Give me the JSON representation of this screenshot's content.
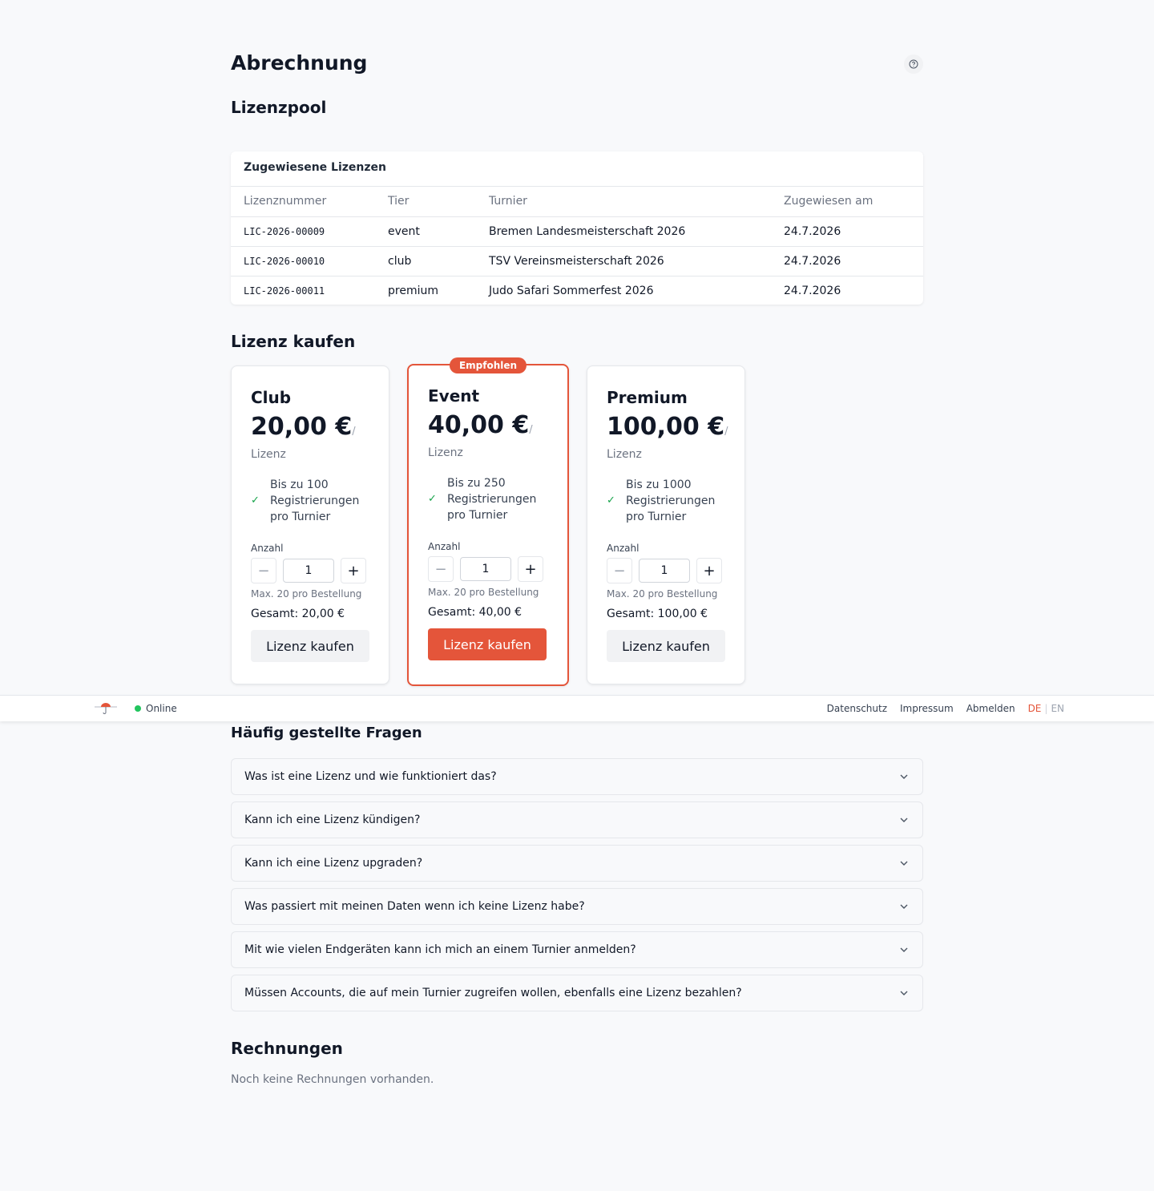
{
  "page": {
    "title": "Abrechnung"
  },
  "pool": {
    "section_title": "Lizenzpool",
    "card_title": "Zugewiesene Lizenzen",
    "columns": [
      "Lizenznummer",
      "Tier",
      "Turnier",
      "Zugewiesen am"
    ],
    "rows": [
      [
        "LIC-2026-00009",
        "event",
        "Bremen Landesmeisterschaft 2026",
        "24.7.2026"
      ],
      [
        "LIC-2026-00010",
        "club",
        "TSV Vereinsmeisterschaft 2026",
        "24.7.2026"
      ],
      [
        "LIC-2026-00011",
        "premium",
        "Judo Safari Sommerfest 2026",
        "24.7.2026"
      ]
    ]
  },
  "buy": {
    "section_title": "Lizenz kaufen",
    "plans": [
      {
        "name": "Club",
        "price": "20,00 €",
        "per": "/",
        "unit": "Lizenz",
        "feature": "Bis zu 100 Registrierungen pro Turnier",
        "qty_label": "Anzahl",
        "qty": "1",
        "hint": "Max. 20 pro Bestellung",
        "total": "Gesamt: 20,00 €",
        "button": "Lizenz kaufen"
      },
      {
        "name": "Event",
        "badge": "Empfohlen",
        "price": "40,00 €",
        "per": "/",
        "unit": "Lizenz",
        "feature": "Bis zu 250 Registrierungen pro Turnier",
        "qty_label": "Anzahl",
        "qty": "1",
        "hint": "Max. 20 pro Bestellung",
        "total": "Gesamt: 40,00 €",
        "button": "Lizenz kaufen"
      },
      {
        "name": "Premium",
        "price": "100,00 €",
        "per": "/",
        "unit": "Lizenz",
        "feature": "Bis zu 1000 Registrierungen pro Turnier",
        "qty_label": "Anzahl",
        "qty": "1",
        "hint": "Max. 20 pro Bestellung",
        "total": "Gesamt: 100,00 €",
        "button": "Lizenz kaufen"
      }
    ]
  },
  "footer": {
    "status": "Online",
    "links": [
      "Datenschutz",
      "Impressum",
      "Abmelden"
    ],
    "lang_active": "DE",
    "lang_sep": "|",
    "lang_other": "EN"
  },
  "faq": {
    "section_title": "Häufig gestellte Fragen",
    "items": [
      "Was ist eine Lizenz und wie funktioniert das?",
      "Kann ich eine Lizenz kündigen?",
      "Kann ich eine Lizenz upgraden?",
      "Was passiert mit meinen Daten wenn ich keine Lizenz habe?",
      "Mit wie vielen Endgeräten kann ich mich an einem Turnier anmelden?",
      "Müssen Accounts, die auf mein Turnier zugreifen wollen, ebenfalls eine Lizenz bezahlen?"
    ]
  },
  "invoices": {
    "section_title": "Rechnungen",
    "empty": "Noch keine Rechnungen vorhanden."
  },
  "colors": {
    "accent": "#e4553a",
    "online": "#22c55e",
    "check": "#16a34a"
  }
}
